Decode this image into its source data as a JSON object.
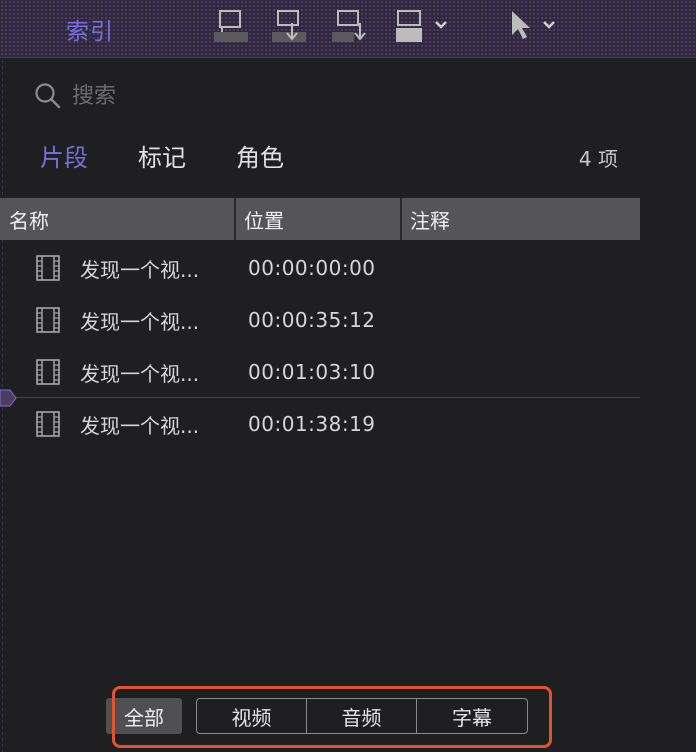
{
  "header": {
    "title": "索引"
  },
  "search": {
    "placeholder": "搜索"
  },
  "tabs": [
    {
      "label": "片段",
      "active": true
    },
    {
      "label": "标记",
      "active": false
    },
    {
      "label": "角色",
      "active": false
    }
  ],
  "count_label": "4 项",
  "table": {
    "columns": [
      "名称",
      "位置",
      "注释"
    ],
    "rows": [
      {
        "name": "发现一个视...",
        "position": "00:00:00:00",
        "note": ""
      },
      {
        "name": "发现一个视...",
        "position": "00:00:35:12",
        "note": ""
      },
      {
        "name": "发现一个视...",
        "position": "00:01:03:10",
        "note": ""
      },
      {
        "name": "发现一个视...",
        "position": "00:01:38:19",
        "note": ""
      }
    ]
  },
  "filters": {
    "all_label": "全部",
    "segments": [
      "视频",
      "音频",
      "字幕"
    ]
  },
  "colors": {
    "accent": "#7a6fd9",
    "highlight": "#e0552f",
    "header_bg": "#555557",
    "background": "#1f1f21"
  },
  "icons": {
    "search": "search-icon",
    "clip": "film-icon",
    "insert": "insert-clip-icon",
    "pointer": "arrow-pointer-icon"
  }
}
